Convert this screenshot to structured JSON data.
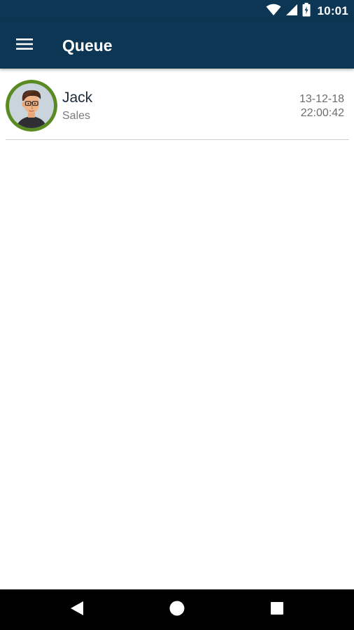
{
  "status_bar": {
    "time": "10:01",
    "icons": [
      "wifi-icon",
      "signal-icon",
      "battery-icon"
    ]
  },
  "app_bar": {
    "title": "Queue",
    "menu_icon": "hamburger-menu-icon"
  },
  "queue": {
    "items": [
      {
        "name": "Jack",
        "department": "Sales",
        "date": "13-12-18",
        "time": "22:00:42",
        "avatar_icon": "person-avatar-icon",
        "avatar_ring_color": "#5a8a22"
      }
    ]
  },
  "nav_bar": {
    "icons": [
      "back-icon",
      "home-icon",
      "recents-icon"
    ]
  },
  "colors": {
    "primary": "#0c3653",
    "background": "#ffffff",
    "divider": "#cfcfcf",
    "nav_bar": "#000000"
  }
}
